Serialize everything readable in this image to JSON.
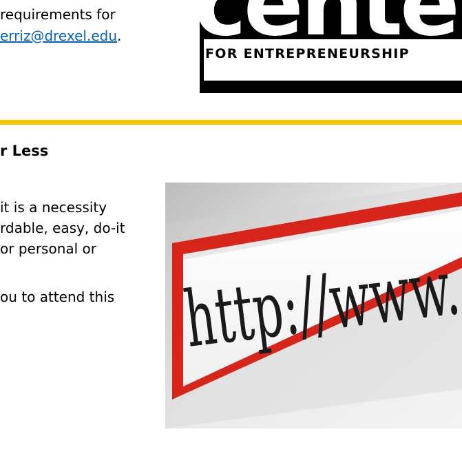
{
  "requirements": {
    "line1": "requirements for",
    "email": "erriz@drexel.edu",
    "email_suffix": "."
  },
  "logo": {
    "word": "center",
    "subtitle": "FOR ENTREPRENEURSHIP"
  },
  "colors": {
    "rule": "#f7c600",
    "link": "#0563c1",
    "arrow_red": "#d8251c"
  },
  "article": {
    "heading": "r Less",
    "para1_lines": [
      "it is a necessity",
      "rdable, easy, do-it",
      "or personal or"
    ],
    "para2": "ou to attend this"
  },
  "photo": {
    "text": "http://www."
  }
}
